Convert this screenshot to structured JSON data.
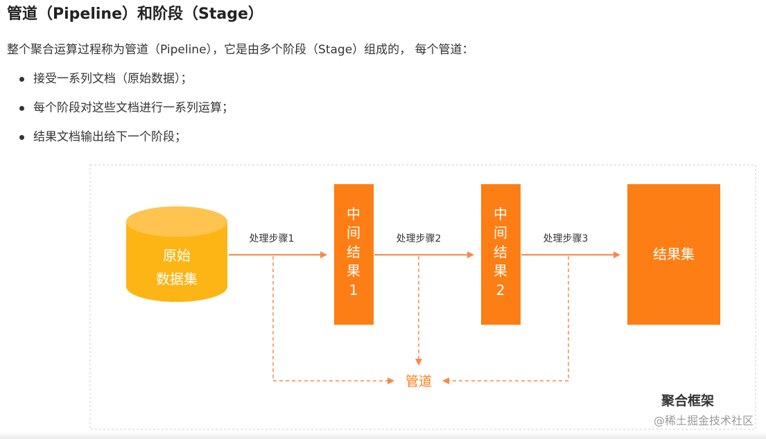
{
  "heading": "管道（Pipeline）和阶段（Stage）",
  "intro": "整个聚合运算过程称为管道（Pipeline），它是由多个阶段（Stage）组成的， 每个管道：",
  "bullets": [
    "接受一系列文档（原始数据）；",
    "每个阶段对这些文档进行一系列运算；",
    "结果文档输出给下一个阶段；"
  ],
  "diagram": {
    "source": [
      "原始",
      "数据集"
    ],
    "steps": [
      "处理步骤1",
      "处理步骤2",
      "处理步骤3"
    ],
    "intermediate1": [
      "中",
      "间",
      "结",
      "果",
      "1"
    ],
    "intermediate2": [
      "中",
      "间",
      "结",
      "果",
      "2"
    ],
    "result": "结果集",
    "pipeline_label": "管道",
    "framework_label": "聚合框架"
  },
  "colors": {
    "orange": "#fd7e14",
    "cylinder": "#fdb515",
    "dashed": "#f5894a",
    "border": "#dddddd"
  },
  "watermark": "@稀土掘金技术社区"
}
